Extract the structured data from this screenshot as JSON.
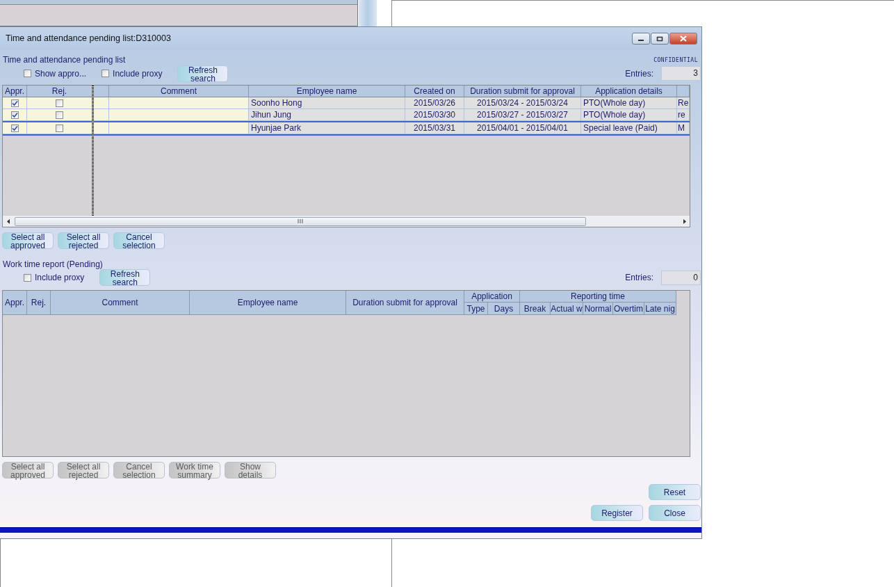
{
  "window": {
    "title": "Time and attendance pending list:D310003"
  },
  "pending": {
    "heading": "Time and attendance pending list",
    "confidential": "CONFIDENTIAL",
    "options": [
      {
        "label": "Show appro...",
        "checked": false
      },
      {
        "label": "Include proxy",
        "checked": false
      }
    ],
    "refresh_button": "Refresh search",
    "entries_label": "Entries:",
    "entries_value": "3",
    "columns": [
      "Appr.",
      "Rej.",
      "Comment",
      "Employee name",
      "Created on",
      "Duration submit for approval",
      "Application details"
    ],
    "rows": [
      {
        "approved": true,
        "rejected": false,
        "selected": false,
        "employee": "Soonho Hong",
        "created_on": "2015/03/26",
        "duration": "2015/03/24 - 2015/03/24",
        "details": "PTO(Whole day)",
        "column_9": "Re"
      },
      {
        "approved": true,
        "rejected": false,
        "selected": false,
        "employee": "Jihun Jung",
        "created_on": "2015/03/30",
        "duration": "2015/03/27 - 2015/03/27",
        "details": "PTO(Whole day)",
        "column_9": "re"
      },
      {
        "approved": true,
        "rejected": false,
        "selected": true,
        "employee": "Hyunjae Park",
        "created_on": "2015/03/31",
        "duration": "2015/04/01  -  2015/04/01",
        "details": "Special leave (Paid)",
        "column_9": "M"
      }
    ],
    "buttons": [
      {
        "label": "Select all approved",
        "disabled": false
      },
      {
        "label": "Select all rejected",
        "disabled": false
      },
      {
        "label": "Cancel selection",
        "disabled": false
      }
    ]
  },
  "work_report": {
    "heading": "Work time report (Pending)",
    "options": [
      {
        "label": "Include proxy",
        "checked": false
      }
    ],
    "refresh_button": "Refresh search",
    "entries_label": "Entries:",
    "entries_value": "0",
    "columns": [
      {
        "label": "Appr."
      },
      {
        "label": "Rej."
      },
      {
        "label": "Comment"
      },
      {
        "label": "Employee name"
      },
      {
        "label": "Duration submit for approval"
      },
      {
        "label": "Application",
        "children": [
          {
            "label": "Type"
          },
          {
            "label": "Days"
          }
        ]
      },
      {
        "label": "Reporting time",
        "children": [
          {
            "label": "Break"
          },
          {
            "label": "Actual w"
          },
          {
            "label": "Normal"
          },
          {
            "label": "Overtim"
          },
          {
            "label": "Late nig"
          }
        ]
      }
    ],
    "buttons": [
      {
        "label": "Select all approved",
        "disabled": true
      },
      {
        "label": "Select all rejected",
        "disabled": true
      },
      {
        "label": "Cancel selection",
        "disabled": true
      },
      {
        "label": "Work time summary",
        "disabled": true
      },
      {
        "label": "Show details",
        "disabled": true
      }
    ]
  },
  "footer": {
    "reset": "Reset",
    "register": "Register",
    "close": "Close"
  }
}
